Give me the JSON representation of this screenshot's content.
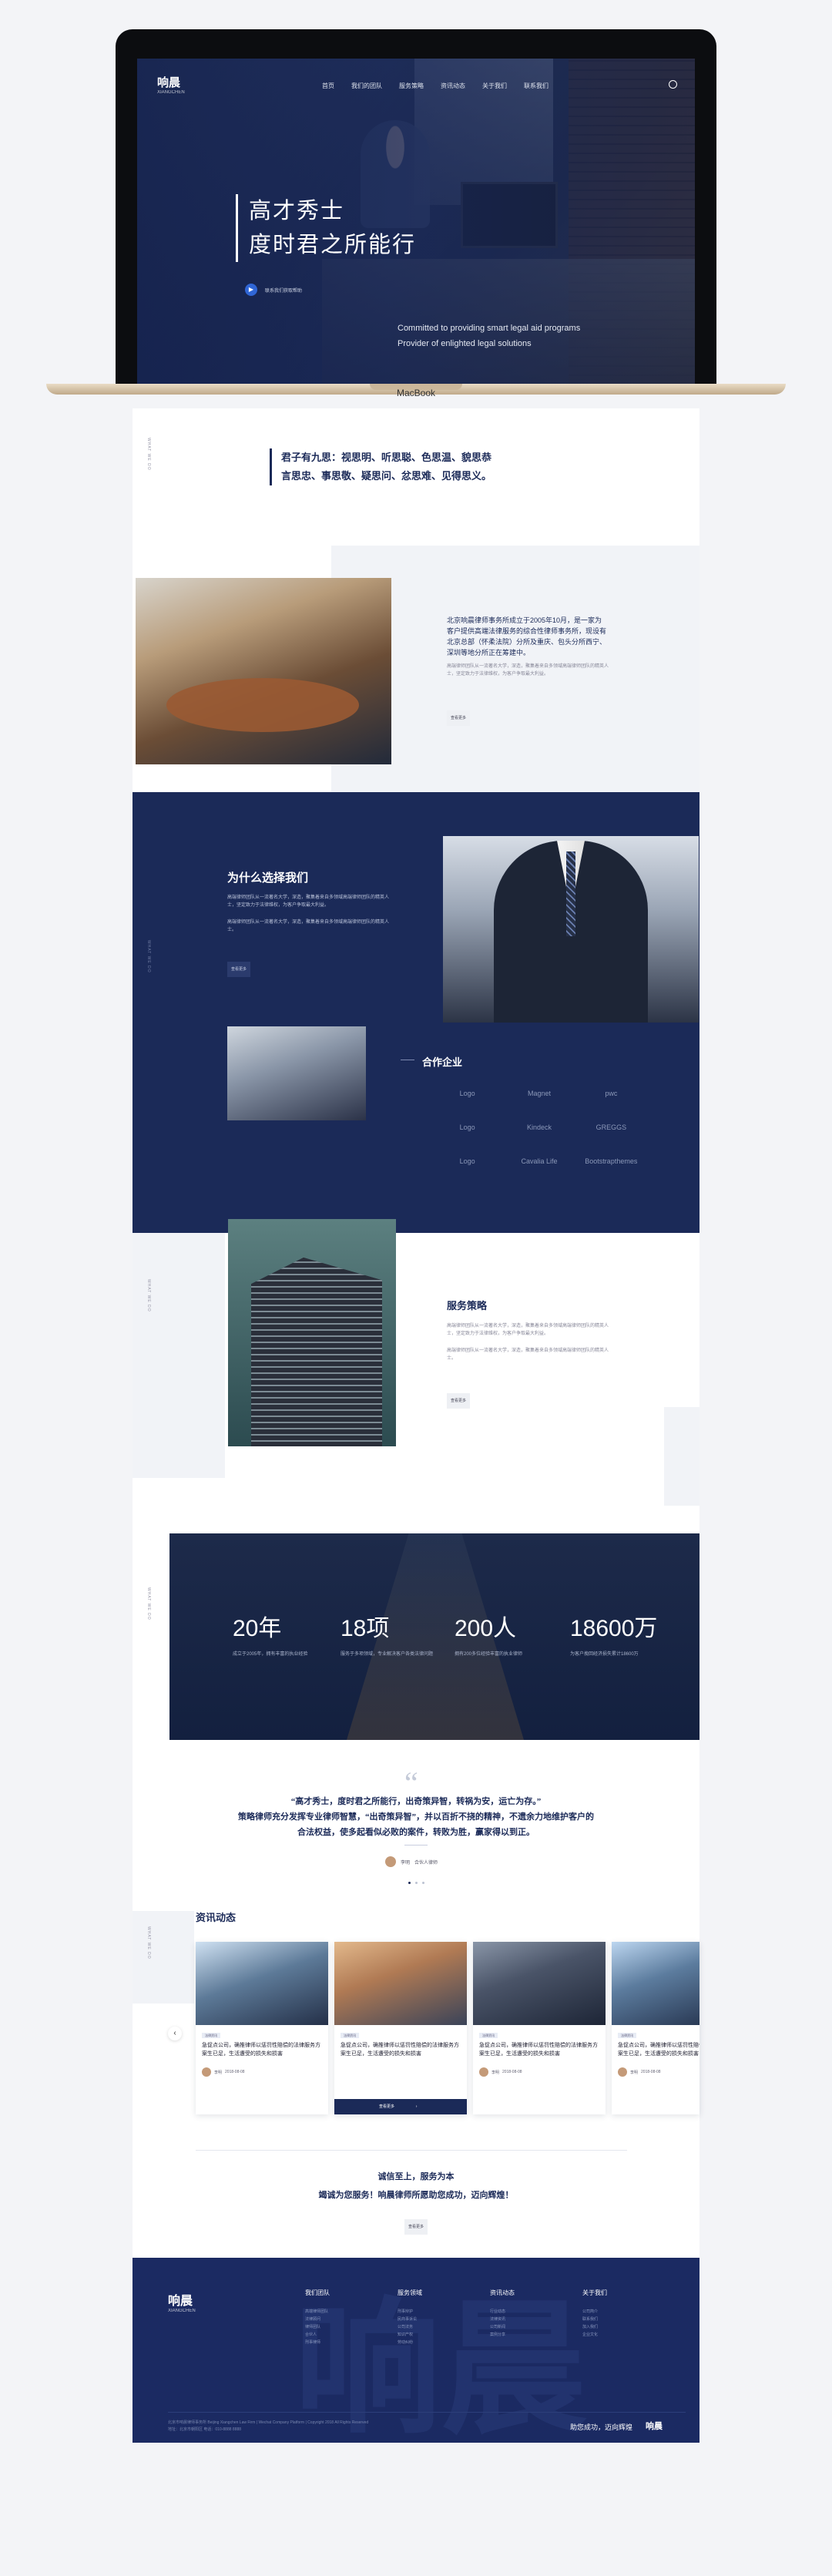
{
  "nav": {
    "logo": "响晨",
    "logo_sub": "XIANGCHEN",
    "items": [
      "首页",
      "我们的团队",
      "服务策略",
      "资讯动态",
      "关于我们",
      "联系我们"
    ]
  },
  "hero": {
    "line1": "高才秀士",
    "line2": "度时君之所能行",
    "btn_label": "联系我们获取帮助",
    "en1": "Committed to providing smart legal aid programs",
    "en2": "Provider of enlighted legal solutions"
  },
  "device_brand": "MacBook",
  "side_label": "WHAT WE DO",
  "intro_quote": {
    "line1": "君子有九思：视思明、听思聪、色思温、貌思恭",
    "line2": "言思忠、事思敬、疑思问、忿思难、见得思义。"
  },
  "about": {
    "text": "北京响晨律师事务所成立于2005年10月，是一家为客户提供高端法律服务的综合性律师事务所，现设有北京总部（怀柔法院）分所及重庆、包头分所西宁、深圳等地分所正在筹建中。",
    "sub": "高端律师团队从一流著名大学，深造，聚集着来自多领域高端律师团队的精英人士，坚定致力于法律维权，为客户争取最大利益。",
    "btn": "查看更多"
  },
  "why": {
    "title": "为什么选择我们",
    "text1": "高端律师团队从一流著名大学，深造，聚集着来自多领域高端律师团队的精英人士，坚定致力于法律维权，为客户争取最大利益。",
    "text2": "高端律师团队从一流著名大学，深造，聚集着来自多领域高端律师团队的精英人士。",
    "btn": "查看更多"
  },
  "partners": {
    "title": "合作企业",
    "logos": [
      "Logo",
      "Magnet",
      "pwc",
      "Logo",
      "Kindeck",
      "GREGGS",
      "Logo",
      "Cavalia Life",
      "Bootstrapthemes"
    ]
  },
  "strategy": {
    "title": "服务策略",
    "text1": "高端律师团队从一流著名大学，深造，聚集着来自多领域高端律师团队的精英人士，坚定致力于法律维权，为客户争取最大利益。",
    "text2": "高端律师团队从一流著名大学，深造，聚集着来自多领域高端律师团队的精英人士。",
    "btn": "查看更多"
  },
  "stats": [
    {
      "num": "20年",
      "desc": "成立于2005年，拥有丰富的执业经验"
    },
    {
      "num": "18项",
      "desc": "服务于多项领域，专业解决客户各类法律问题"
    },
    {
      "num": "200人",
      "desc": "拥有200多位经验丰富的执业律师"
    },
    {
      "num": "18600万",
      "desc": "为客户挽回经济损失累计18600万"
    }
  ],
  "testimonial": {
    "mark": "“",
    "line1": "“高才秀士，度时君之所能行，出奇策异智，转祸为安，运亡为存。”",
    "line2": "策略律师充分发挥专业律师智慧，“出奇策异智”，并以百折不挠的精神，不遗余力地维护客户的",
    "line3": "合法权益，使多起看似必败的案件，转败为胜，赢家得以到正。",
    "author": "李明",
    "role": "合伙人律师"
  },
  "news": {
    "title": "资讯动态",
    "cards": [
      {
        "tag": "法律资讯",
        "title": "急促点公司，确推律师以惩罚性赔偿的法律服务方案生已足，生活遭受的损失和损害",
        "author": "李明",
        "date": "2018-08-08"
      },
      {
        "tag": "法律资讯",
        "title": "急促点公司，确推律师以惩罚性赔偿的法律服务方案生已足，生活遭受的损失和损害",
        "author": "查看更多",
        "date": ""
      },
      {
        "tag": "法律资讯",
        "title": "急促点公司，确推律师以惩罚性赔偿的法律服务方案生已足，生活遭受的损失和损害",
        "author": "李明",
        "date": "2018-08-08"
      },
      {
        "tag": "法律资讯",
        "title": "急促点公司，确推律师以惩罚性赔偿的法律服务方案生已足，生活遭受的损失和损害",
        "author": "李明",
        "date": "2018-08-08"
      }
    ]
  },
  "cta": {
    "line1": "诚信至上，服务为本",
    "line2": "竭诚为您服务！响晨律师所愿助您成功，迈向辉煌！",
    "btn": "查看更多"
  },
  "footer": {
    "logo": "响晨",
    "logo_sub": "XIANGCHEN",
    "watermark": "响晨",
    "cols": [
      {
        "title": "我们团队",
        "items": [
          "高端律师团队",
          "法律顾问",
          "律师团队",
          "合伙人",
          "刑事律师"
        ]
      },
      {
        "title": "服务领域",
        "items": [
          "刑事辩护",
          "民商事诉讼",
          "公司法务",
          "知识产权",
          "劳动纠纷"
        ]
      },
      {
        "title": "资讯动态",
        "items": [
          "行业动态",
          "法律资讯",
          "公司新闻",
          "案例分享"
        ]
      },
      {
        "title": "关于我们",
        "items": [
          "公司简介",
          "联系我们",
          "加入我们",
          "企业文化"
        ]
      }
    ],
    "copy1": "北京市响晨律师事务所 Beijing Xiangchen Law Firm | Wechat Company Platform | Copyright 2018 All Rights Reserved",
    "copy2": "地址：北京市朝阳区 电话：010-8888 8888",
    "slogan": "助您成功，迈向辉煌",
    "logo2": "响晨"
  },
  "colors": {
    "navy": "#1b2a58",
    "accent": "#3066d6"
  }
}
